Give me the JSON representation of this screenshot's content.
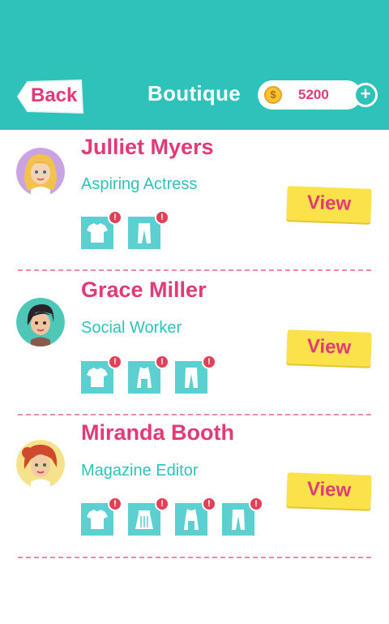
{
  "header": {
    "back_label": "Back",
    "title": "Boutique",
    "coins": "5200",
    "coin_symbol": "$",
    "plus_symbol": "+"
  },
  "customers": [
    {
      "name": "Julliet Myers",
      "job": "Aspiring Actress",
      "items": [
        "shirt",
        "pants"
      ],
      "view_label": "View"
    },
    {
      "name": "Grace Miller",
      "job": "Social Worker",
      "items": [
        "shirt",
        "dress",
        "pants"
      ],
      "view_label": "View"
    },
    {
      "name": "Miranda Booth",
      "job": "Magazine Editor",
      "items": [
        "shirt",
        "skirt",
        "dress",
        "pants"
      ],
      "view_label": "View"
    }
  ],
  "badge_symbol": "!",
  "colors": {
    "header_bg": "#2ec2ba",
    "name": "#e23a78",
    "job": "#2ec2ba",
    "item_tile": "#5ccfd0",
    "view_button": "#fbe24b",
    "badge": "#e04158",
    "divider": "#ee8aa4"
  }
}
